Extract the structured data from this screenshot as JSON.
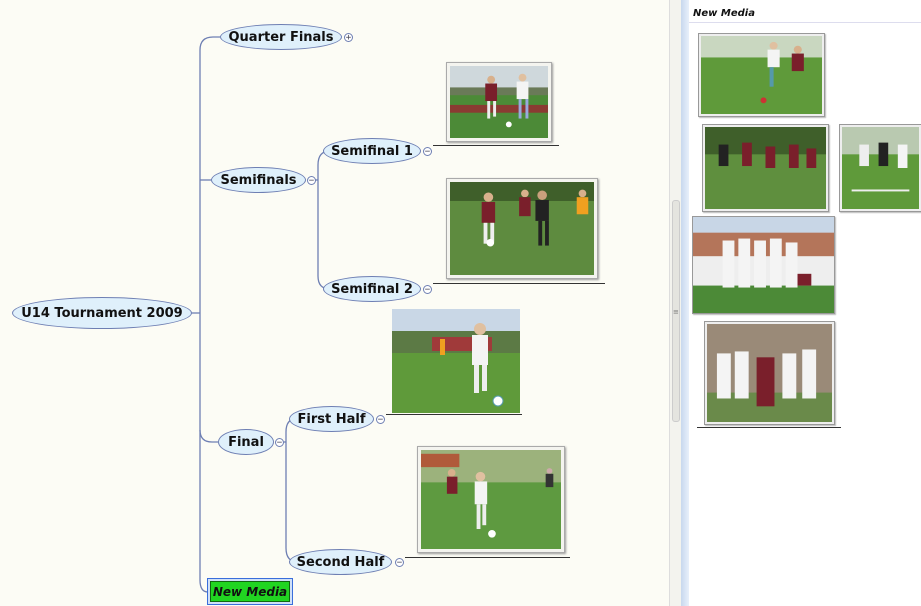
{
  "mindmap": {
    "root": "U14 Tournament 2009",
    "branches": {
      "quarter": "Quarter Finals",
      "semis": "Semifinals",
      "semi1": "Semifinal 1",
      "semi2": "Semifinal 2",
      "final": "Final",
      "first_half": "First Half",
      "second_half": "Second Half",
      "new_media": "New Media"
    },
    "toggles": {
      "expand": "+",
      "collapse": "−"
    }
  },
  "media_panel": {
    "title": "New Media"
  },
  "colors": {
    "node_fill": "#dff0fb",
    "node_border": "#6e7fb3",
    "new_media_fill": "#21d521",
    "grass": "#4c8a37",
    "jersey_red": "#7a1f2b",
    "jersey_white": "#f4f4f4"
  }
}
